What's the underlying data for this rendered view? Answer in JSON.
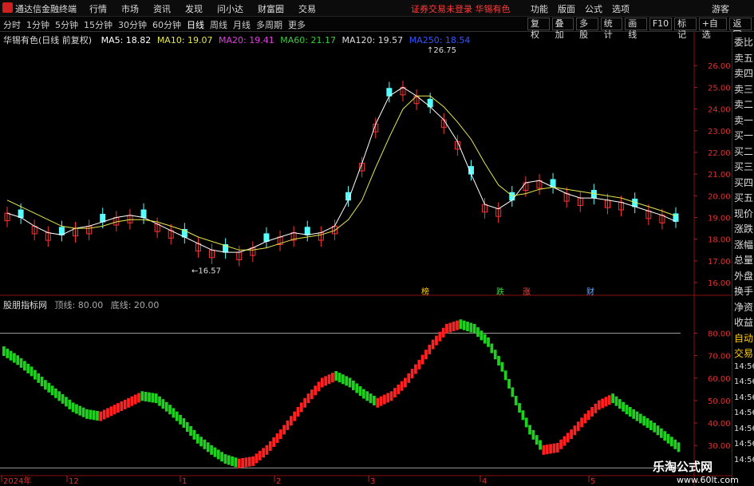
{
  "app": {
    "name": "通达信金融终端",
    "status": "证券交易未登录  华锡有色",
    "guest": "游客"
  },
  "menu": [
    "行情",
    "市场",
    "资讯",
    "发现",
    "问小达",
    "财富圈",
    "交易"
  ],
  "right_menu": [
    "功能",
    "版面",
    "公式",
    "选项"
  ],
  "toolbar": {
    "periods": [
      "分时",
      "1分钟",
      "5分钟",
      "15分钟",
      "30分钟",
      "60分钟",
      "日线",
      "周线",
      "月线",
      "多周期",
      "更多"
    ],
    "active": "日线",
    "buttons": [
      "复权",
      "叠加",
      "多股",
      "统计",
      "画线",
      "F10",
      "标记",
      "+自选",
      "返回"
    ]
  },
  "main": {
    "name": "华锡有色(日线 前复权)",
    "ma": [
      {
        "label": "MA5: 18.82",
        "color": "#ffffff"
      },
      {
        "label": "MA10: 19.07",
        "color": "#e6e64d"
      },
      {
        "label": "MA20: 19.41",
        "color": "#e23de2"
      },
      {
        "label": "MA60: 21.17",
        "color": "#39cc39"
      },
      {
        "label": "MA120: 19.57",
        "color": "#dddddd"
      },
      {
        "label": "MA250: 18.54",
        "color": "#3355ff"
      }
    ],
    "high_label": "26.75",
    "low_label": "16.57",
    "y_ticks": [
      "26.00",
      "25.00",
      "24.00",
      "23.00",
      "22.00",
      "21.00",
      "20.00",
      "19.00",
      "18.00",
      "17.00",
      "16.00"
    ],
    "markers": [
      {
        "t": "榜",
        "c": "#ffcc00"
      },
      {
        "t": "跌",
        "c": "#33dd33"
      },
      {
        "t": "涨",
        "c": "#ff4040"
      },
      {
        "t": "财",
        "c": "#66aaff"
      }
    ]
  },
  "indicator": {
    "name": "股朋指标网",
    "top": "顶线: 80.00",
    "bottom": "底线: 20.00",
    "y_ticks": [
      "80.00",
      "70.00",
      "60.00",
      "50.00",
      "40.00",
      "30.00"
    ]
  },
  "x_axis": [
    "2024年",
    "12",
    "1",
    "2",
    "3",
    "4",
    "5"
  ],
  "sidebar": [
    "委比",
    "卖五",
    "卖四",
    "卖三",
    "卖二",
    "卖一",
    "买一",
    "买二",
    "买三",
    "买四",
    "买五",
    "现价",
    "涨跌",
    "涨幅",
    "总量",
    "外盘",
    "换手",
    "净资",
    "收益",
    "自动",
    "交易",
    "14:56",
    "14:56",
    "14:56",
    "14:56",
    "14:56",
    "14:56",
    "14:56"
  ],
  "watermark": {
    "title": "乐淘公式网",
    "url": "www.60lt.com"
  },
  "colors": {
    "up": "#ff3232",
    "down": "#54ffff",
    "bull": "#ff2020",
    "bear": "#20d020",
    "grid": "#8a1010"
  },
  "chart_data": {
    "type": "line",
    "title": "",
    "xlabel": "",
    "ylabel": "",
    "ylim": [
      15.6,
      27.0
    ],
    "series": [
      {
        "name": "MA5",
        "values": [
          19.2,
          19.0,
          18.6,
          18.3,
          18.2,
          18.5,
          18.6,
          18.8,
          19.0,
          19.1,
          19.0,
          18.7,
          18.4,
          18.1,
          17.8,
          17.5,
          17.4,
          17.4,
          17.6,
          17.9,
          18.1,
          18.3,
          18.2,
          18.3,
          18.6,
          19.8,
          21.5,
          23.3,
          24.6,
          25.0,
          24.6,
          24.1,
          23.5,
          22.5,
          21.0,
          19.6,
          19.4,
          19.8,
          20.6,
          20.7,
          20.4,
          20.1,
          19.9,
          19.9,
          19.8,
          19.7,
          19.5,
          19.3,
          19.1,
          18.82
        ]
      },
      {
        "name": "MA10",
        "values": [
          19.8,
          19.5,
          19.2,
          18.9,
          18.6,
          18.5,
          18.5,
          18.6,
          18.8,
          18.9,
          18.9,
          18.8,
          18.6,
          18.4,
          18.1,
          17.9,
          17.7,
          17.5,
          17.5,
          17.6,
          17.8,
          18.0,
          18.1,
          18.2,
          18.4,
          18.9,
          19.8,
          21.3,
          22.7,
          24.0,
          24.6,
          24.6,
          24.1,
          23.4,
          22.6,
          21.5,
          20.5,
          20.0,
          20.1,
          20.3,
          20.4,
          20.3,
          20.2,
          20.1,
          20.0,
          19.9,
          19.7,
          19.5,
          19.3,
          19.07
        ]
      }
    ],
    "ind_values": [
      72,
      68,
      63,
      57,
      52,
      47,
      44,
      43,
      46,
      49,
      52,
      51,
      46,
      40,
      33,
      28,
      24,
      22,
      23,
      28,
      35,
      43,
      51,
      58,
      61,
      58,
      53,
      49,
      52,
      58,
      66,
      75,
      82,
      84,
      82,
      76,
      65,
      50,
      37,
      28,
      29,
      35,
      42,
      48,
      51,
      46,
      42,
      38,
      33,
      28
    ],
    "ind_ylim": [
      18,
      88
    ],
    "ind_top": 80,
    "ind_bottom": 20
  }
}
